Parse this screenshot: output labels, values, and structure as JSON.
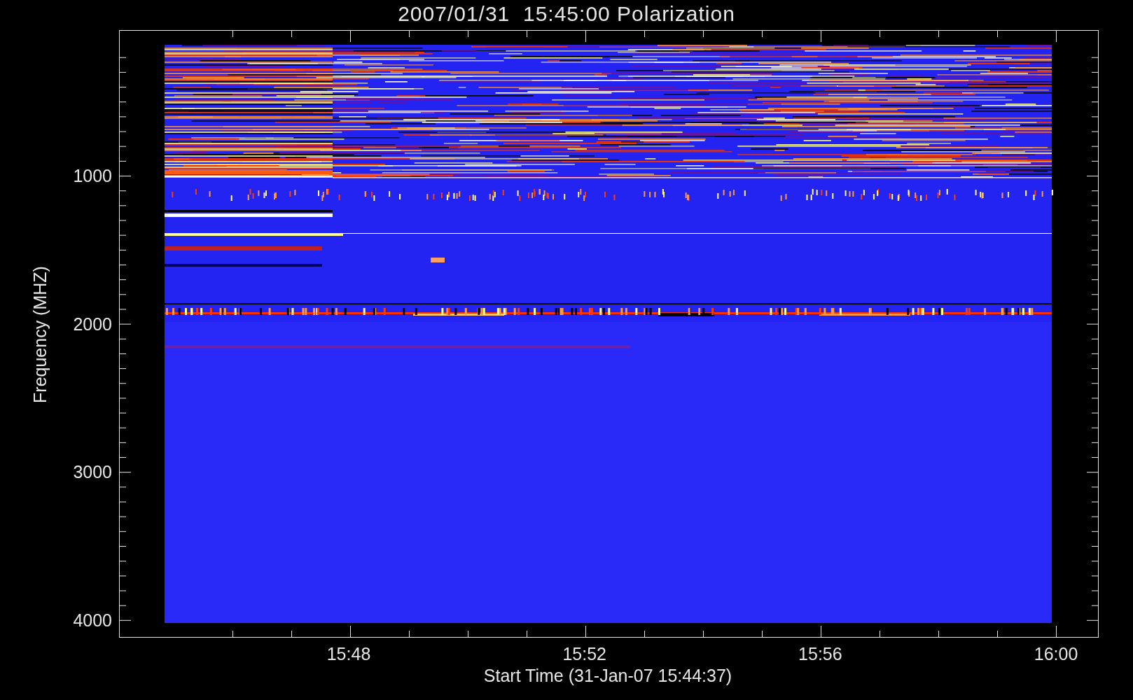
{
  "title": "2007/01/31  15:45:00 Polarization",
  "plot": {
    "ylabel": "Frequency (MHZ)",
    "xlabel": "Start Time (31-Jan-07 15:44:37)",
    "yticks": [
      "1000",
      "2000",
      "3000",
      "4000"
    ],
    "xticks": [
      "15:48",
      "15:52",
      "15:56",
      "16:00"
    ]
  }
}
